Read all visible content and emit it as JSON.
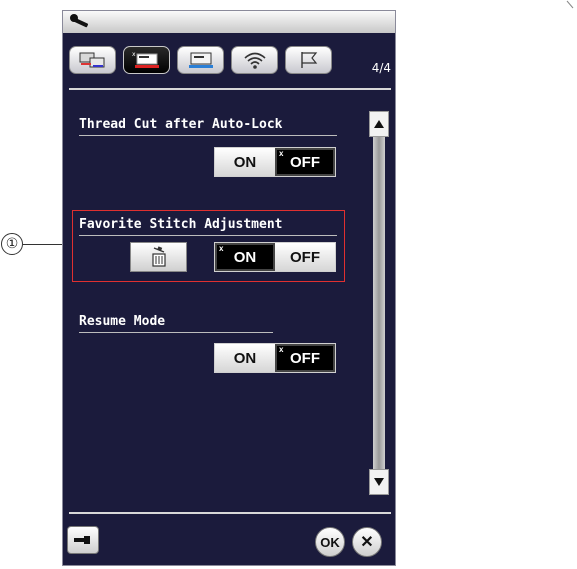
{
  "header": {
    "icon": "wrench-icon"
  },
  "tabs": [
    {
      "name": "tab-machine-settings",
      "icon": "machine-screen-icon"
    },
    {
      "name": "tab-sewing-settings",
      "icon": "sewing-machine-icon",
      "active": true
    },
    {
      "name": "tab-embroidery-settings",
      "icon": "embroidery-screen-icon"
    },
    {
      "name": "tab-wireless-settings",
      "icon": "wifi-icon"
    },
    {
      "name": "tab-language-settings",
      "icon": "flag-icon"
    }
  ],
  "page_indicator": "4/4",
  "settings": {
    "thread_cut": {
      "label": "Thread Cut after Auto-Lock",
      "on": "ON",
      "off": "OFF",
      "selected": "OFF"
    },
    "favorite_stitch": {
      "label": "Favorite Stitch Adjustment",
      "on": "ON",
      "off": "OFF",
      "selected": "ON"
    },
    "resume_mode": {
      "label": "Resume Mode",
      "on": "ON",
      "off": "OFF",
      "selected": "OFF"
    }
  },
  "footer": {
    "ok_label": "OK",
    "close_label": "✕"
  },
  "callout": {
    "number": "①"
  },
  "colors": {
    "screen_bg": "#1b1b3c",
    "highlight": "#e03030",
    "selected": "#000000"
  }
}
